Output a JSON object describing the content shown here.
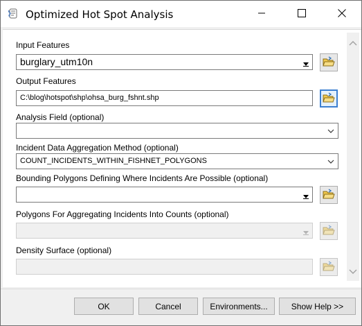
{
  "window": {
    "title": "Optimized Hot Spot Analysis",
    "app_icon": "python-script-tool-icon"
  },
  "titlebar_controls": [
    "minimize-icon",
    "maximize-icon",
    "close-icon"
  ],
  "params": {
    "input_features": {
      "label": "Input Features",
      "value": "burglary_utm10n"
    },
    "output_features": {
      "label": "Output Features",
      "value": "C:\\blog\\hotspot\\shp\\ohsa_burg_fshnt.shp"
    },
    "analysis_field": {
      "label": "Analysis Field (optional)",
      "value": ""
    },
    "aggregation_method": {
      "label": "Incident Data Aggregation Method (optional)",
      "value": "COUNT_INCIDENTS_WITHIN_FISHNET_POLYGONS"
    },
    "bounding_polygons": {
      "label": "Bounding Polygons Defining Where Incidents Are Possible (optional)",
      "value": ""
    },
    "aggregating_polygons": {
      "label": "Polygons For Aggregating Incidents Into Counts (optional)",
      "value": ""
    },
    "density_surface": {
      "label": "Density Surface (optional)",
      "value": ""
    }
  },
  "buttons": {
    "ok": "OK",
    "cancel": "Cancel",
    "environments": "Environments...",
    "show_help": "Show Help >>"
  },
  "colors": {
    "focus_border": "#3c7fd1",
    "folder_yellow": "#f2c94c"
  }
}
